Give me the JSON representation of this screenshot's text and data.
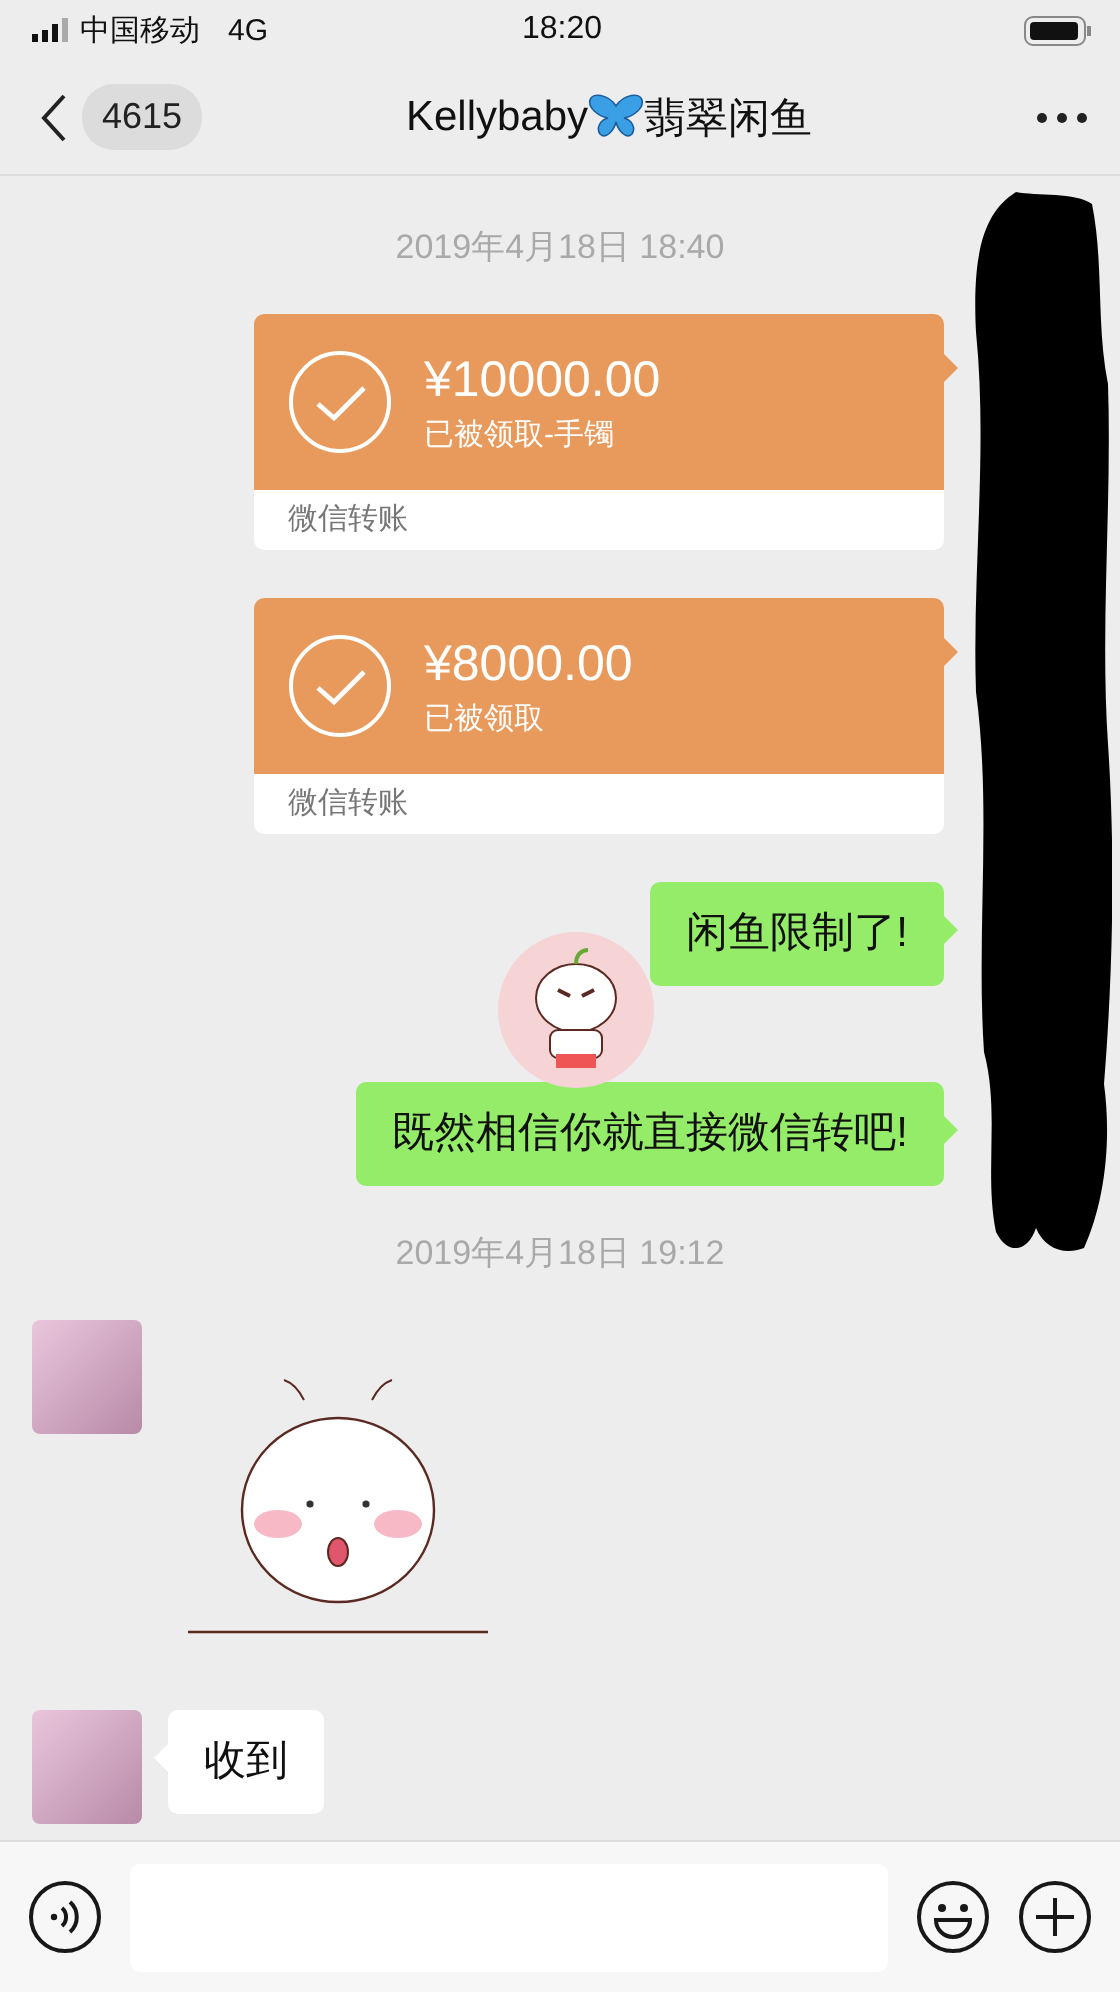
{
  "status_bar": {
    "carrier": "中国移动",
    "network": "4G",
    "time": "18:20"
  },
  "nav": {
    "unread_count": "4615",
    "title_name": "Kellybaby",
    "title_group": "翡翠闲鱼"
  },
  "messages": [
    {
      "kind": "time",
      "text": "2019年4月18日 18:40"
    },
    {
      "kind": "transfer",
      "outgoing": true,
      "amount": "¥10000.00",
      "status": "已被领取-手镯",
      "footer": "微信转账"
    },
    {
      "kind": "transfer",
      "outgoing": true,
      "amount": "¥8000.00",
      "status": "已被领取",
      "footer": "微信转账"
    },
    {
      "kind": "text",
      "outgoing": true,
      "text": "闲鱼限制了!"
    },
    {
      "kind": "sticker",
      "outgoing": true
    },
    {
      "kind": "text",
      "outgoing": true,
      "text": "既然相信你就直接微信转吧!"
    },
    {
      "kind": "time",
      "text": "2019年4月18日 19:12"
    },
    {
      "kind": "sticker",
      "outgoing": false
    },
    {
      "kind": "text",
      "outgoing": false,
      "text": "收到"
    }
  ]
}
